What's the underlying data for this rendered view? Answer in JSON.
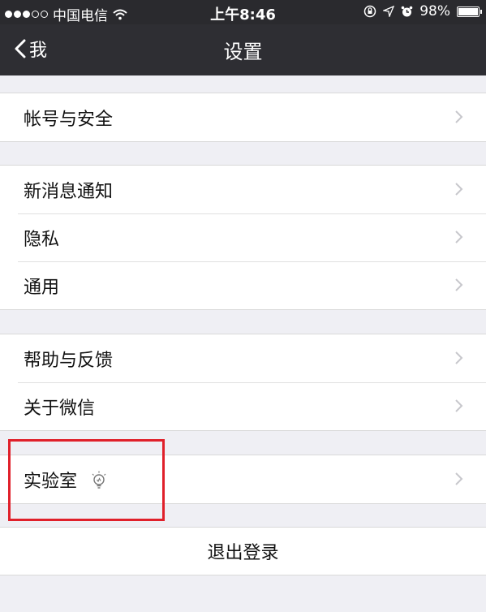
{
  "status_bar": {
    "carrier": "中国电信",
    "time": "上午8:46",
    "battery": "98%",
    "battery_level": 0.98
  },
  "nav": {
    "back_label": "我",
    "title": "设置"
  },
  "groups": [
    {
      "items": [
        {
          "label": "帐号与安全"
        }
      ]
    },
    {
      "items": [
        {
          "label": "新消息通知"
        },
        {
          "label": "隐私"
        },
        {
          "label": "通用"
        }
      ]
    },
    {
      "items": [
        {
          "label": "帮助与反馈"
        },
        {
          "label": "关于微信"
        }
      ]
    },
    {
      "items": [
        {
          "label": "实验室",
          "icon": "lightbulb-icon"
        }
      ]
    }
  ],
  "logout_label": "退出登录",
  "colors": {
    "nav_bg": "#2e2e33",
    "page_bg": "#efeff4",
    "highlight": "#e0202a",
    "chevron": "#c7c7cc"
  }
}
